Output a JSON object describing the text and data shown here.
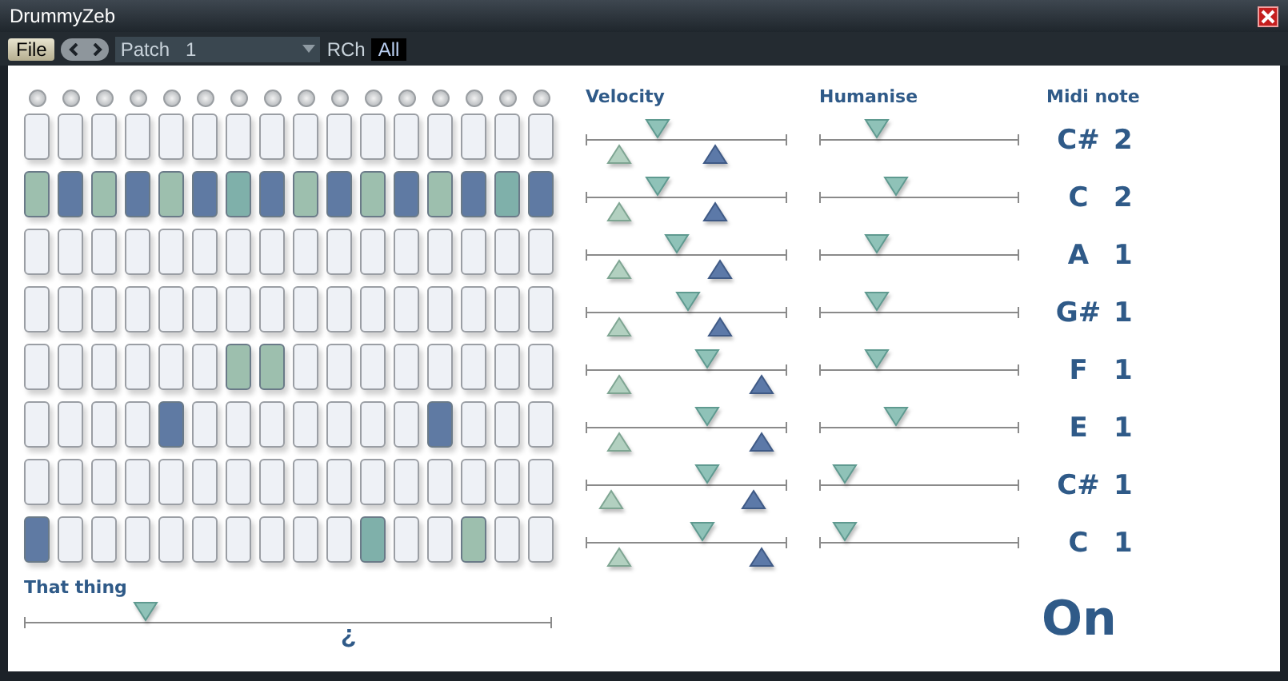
{
  "window": {
    "title": "DrummyZeb"
  },
  "toolbar": {
    "file_button": "File",
    "patch": "Patch   1",
    "channel_label": "RCh",
    "channel_value": "All"
  },
  "headings": {
    "velocity": "Velocity",
    "humanise": "Humanise",
    "midi_note": "Midi note"
  },
  "rows": [
    {
      "cells": [
        {
          "on": false
        },
        {
          "on": false
        },
        {
          "on": false
        },
        {
          "on": false
        },
        {
          "on": false
        },
        {
          "on": false
        },
        {
          "on": false
        },
        {
          "on": false
        },
        {
          "on": false
        },
        {
          "on": false
        },
        {
          "on": false
        },
        {
          "on": false
        },
        {
          "on": false
        },
        {
          "on": false
        },
        {
          "on": false
        },
        {
          "on": false
        }
      ],
      "velocity": [
        {
          "kind": "top",
          "level": 0.36
        },
        {
          "kind": "low",
          "level": 0.17
        },
        {
          "kind": "high",
          "level": 0.64
        }
      ],
      "humanise": {
        "level": 0.29
      },
      "note": "C#",
      "octave": "2"
    },
    {
      "cells": [
        {
          "on": true,
          "color": "#9dbfae"
        },
        {
          "on": true,
          "color": "#5f7aa3"
        },
        {
          "on": true,
          "color": "#9dbfae"
        },
        {
          "on": true,
          "color": "#5f7aa3"
        },
        {
          "on": true,
          "color": "#9dbfae"
        },
        {
          "on": true,
          "color": "#5f7aa3"
        },
        {
          "on": true,
          "color": "#7fb0aa"
        },
        {
          "on": true,
          "color": "#5f7aa3"
        },
        {
          "on": true,
          "color": "#9dbfae"
        },
        {
          "on": true,
          "color": "#5f7aa3"
        },
        {
          "on": true,
          "color": "#9dbfae"
        },
        {
          "on": true,
          "color": "#5f7aa3"
        },
        {
          "on": true,
          "color": "#9dbfae"
        },
        {
          "on": true,
          "color": "#5f7aa3"
        },
        {
          "on": true,
          "color": "#7fb0aa"
        },
        {
          "on": true,
          "color": "#5f7aa3"
        }
      ],
      "velocity": [
        {
          "kind": "top",
          "level": 0.36
        },
        {
          "kind": "low",
          "level": 0.17
        },
        {
          "kind": "high",
          "level": 0.64
        }
      ],
      "humanise": {
        "level": 0.38
      },
      "note": "C",
      "octave": "2"
    },
    {
      "cells": [
        {
          "on": false
        },
        {
          "on": false
        },
        {
          "on": false
        },
        {
          "on": false
        },
        {
          "on": false
        },
        {
          "on": false
        },
        {
          "on": false
        },
        {
          "on": false
        },
        {
          "on": false
        },
        {
          "on": false
        },
        {
          "on": false
        },
        {
          "on": false
        },
        {
          "on": false
        },
        {
          "on": false
        },
        {
          "on": false
        },
        {
          "on": false
        }
      ],
      "velocity": [
        {
          "kind": "top",
          "level": 0.45
        },
        {
          "kind": "low",
          "level": 0.17
        },
        {
          "kind": "high",
          "level": 0.67
        }
      ],
      "humanise": {
        "level": 0.29
      },
      "note": "A",
      "octave": "1"
    },
    {
      "cells": [
        {
          "on": false
        },
        {
          "on": false
        },
        {
          "on": false
        },
        {
          "on": false
        },
        {
          "on": false
        },
        {
          "on": false
        },
        {
          "on": false
        },
        {
          "on": false
        },
        {
          "on": false
        },
        {
          "on": false
        },
        {
          "on": false
        },
        {
          "on": false
        },
        {
          "on": false
        },
        {
          "on": false
        },
        {
          "on": false
        },
        {
          "on": false
        }
      ],
      "velocity": [
        {
          "kind": "top",
          "level": 0.51
        },
        {
          "kind": "low",
          "level": 0.17
        },
        {
          "kind": "high",
          "level": 0.67
        }
      ],
      "humanise": {
        "level": 0.29
      },
      "note": "G#",
      "octave": "1"
    },
    {
      "cells": [
        {
          "on": false
        },
        {
          "on": false
        },
        {
          "on": false
        },
        {
          "on": false
        },
        {
          "on": false
        },
        {
          "on": false
        },
        {
          "on": true,
          "color": "#9dbfae"
        },
        {
          "on": true,
          "color": "#9dbfae"
        },
        {
          "on": false
        },
        {
          "on": false
        },
        {
          "on": false
        },
        {
          "on": false
        },
        {
          "on": false
        },
        {
          "on": false
        },
        {
          "on": false
        },
        {
          "on": false
        }
      ],
      "velocity": [
        {
          "kind": "top",
          "level": 0.6
        },
        {
          "kind": "low",
          "level": 0.17
        },
        {
          "kind": "high",
          "level": 0.87
        }
      ],
      "humanise": {
        "level": 0.29
      },
      "note": "F",
      "octave": "1"
    },
    {
      "cells": [
        {
          "on": false
        },
        {
          "on": false
        },
        {
          "on": false
        },
        {
          "on": false
        },
        {
          "on": true,
          "color": "#5f7aa3"
        },
        {
          "on": false
        },
        {
          "on": false
        },
        {
          "on": false
        },
        {
          "on": false
        },
        {
          "on": false
        },
        {
          "on": false
        },
        {
          "on": false
        },
        {
          "on": true,
          "color": "#5f7aa3"
        },
        {
          "on": false
        },
        {
          "on": false
        },
        {
          "on": false
        }
      ],
      "velocity": [
        {
          "kind": "top",
          "level": 0.6
        },
        {
          "kind": "low",
          "level": 0.17
        },
        {
          "kind": "high",
          "level": 0.87
        }
      ],
      "humanise": {
        "level": 0.38
      },
      "note": "E",
      "octave": "1"
    },
    {
      "cells": [
        {
          "on": false
        },
        {
          "on": false
        },
        {
          "on": false
        },
        {
          "on": false
        },
        {
          "on": false
        },
        {
          "on": false
        },
        {
          "on": false
        },
        {
          "on": false
        },
        {
          "on": false
        },
        {
          "on": false
        },
        {
          "on": false
        },
        {
          "on": false
        },
        {
          "on": false
        },
        {
          "on": false
        },
        {
          "on": false
        },
        {
          "on": false
        }
      ],
      "velocity": [
        {
          "kind": "top",
          "level": 0.6
        },
        {
          "kind": "low",
          "level": 0.13
        },
        {
          "kind": "high",
          "level": 0.83
        }
      ],
      "humanise": {
        "level": 0.13
      },
      "note": "C#",
      "octave": "1"
    },
    {
      "cells": [
        {
          "on": true,
          "color": "#5f7aa3"
        },
        {
          "on": false
        },
        {
          "on": false
        },
        {
          "on": false
        },
        {
          "on": false
        },
        {
          "on": false
        },
        {
          "on": false
        },
        {
          "on": false
        },
        {
          "on": false
        },
        {
          "on": false
        },
        {
          "on": true,
          "color": "#7fb0aa"
        },
        {
          "on": false
        },
        {
          "on": false
        },
        {
          "on": true,
          "color": "#9dbfae"
        },
        {
          "on": false
        },
        {
          "on": false
        }
      ],
      "velocity": [
        {
          "kind": "top",
          "level": 0.58
        },
        {
          "kind": "low",
          "level": 0.17
        },
        {
          "kind": "high",
          "level": 0.87
        }
      ],
      "humanise": {
        "level": 0.13
      },
      "note": "C",
      "octave": "1"
    }
  ],
  "that_thing": {
    "label": "That thing",
    "level": 0.23,
    "center_mark": "¿"
  },
  "power": {
    "label": "On"
  }
}
